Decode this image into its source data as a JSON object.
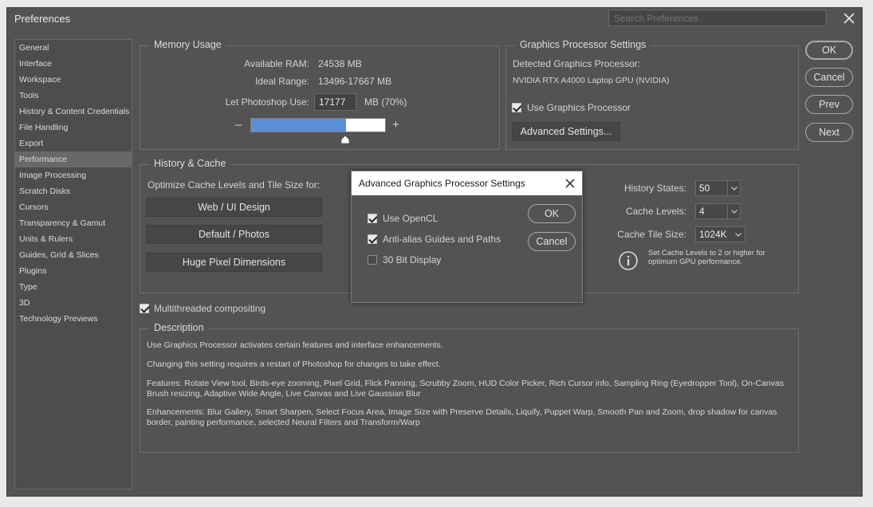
{
  "window": {
    "title": "Preferences",
    "search_placeholder": "Search Preferences"
  },
  "sidebar": {
    "items": [
      {
        "label": "General"
      },
      {
        "label": "Interface"
      },
      {
        "label": "Workspace"
      },
      {
        "label": "Tools"
      },
      {
        "label": "History & Content Credentials"
      },
      {
        "label": "File Handling"
      },
      {
        "label": "Export"
      },
      {
        "label": "Performance"
      },
      {
        "label": "Image Processing"
      },
      {
        "label": "Scratch Disks"
      },
      {
        "label": "Cursors"
      },
      {
        "label": "Transparency & Gamut"
      },
      {
        "label": "Units & Rulers"
      },
      {
        "label": "Guides, Grid & Slices"
      },
      {
        "label": "Plugins"
      },
      {
        "label": "Type"
      },
      {
        "label": "3D"
      },
      {
        "label": "Technology Previews"
      }
    ],
    "active": "Performance"
  },
  "memory": {
    "title": "Memory Usage",
    "available_label": "Available RAM:",
    "available_value": "24538 MB",
    "ideal_label": "Ideal Range:",
    "ideal_value": "13496-17667 MB",
    "let_use_label": "Let Photoshop Use:",
    "let_use_value": "17177",
    "let_use_unit": "MB (70%)",
    "usage_fraction": 0.7,
    "minus": "–",
    "plus": "+"
  },
  "gpu": {
    "title": "Graphics Processor Settings",
    "detected_label": "Detected Graphics Processor:",
    "detected_value": "NVIDIA RTX A4000 Laptop GPU (NVIDIA)",
    "use_gpu_label": "Use Graphics Processor",
    "use_gpu_checked": true,
    "advanced_button": "Advanced Settings..."
  },
  "buttons": {
    "ok": "OK",
    "cancel": "Cancel",
    "prev": "Prev",
    "next": "Next"
  },
  "history_cache": {
    "title": "History & Cache",
    "optimize_label": "Optimize Cache Levels and Tile Size for:",
    "presets": [
      "Web / UI Design",
      "Default / Photos",
      "Huge Pixel Dimensions"
    ],
    "history_states_label": "History States:",
    "history_states_value": "50",
    "cache_levels_label": "Cache Levels:",
    "cache_levels_value": "4",
    "cache_tile_label": "Cache Tile Size:",
    "cache_tile_value": "1024K",
    "info_text": "Set Cache Levels to 2 or higher for optimum GPU performance."
  },
  "multithreaded": {
    "label": "Multithreaded compositing",
    "checked": true
  },
  "description": {
    "title": "Description",
    "paragraphs": [
      "Use Graphics Processor activates certain features and interface enhancements.",
      "Changing this setting requires a restart of Photoshop for changes to take effect.",
      "Features: Rotate View tool, Birds-eye zooming, Pixel Grid, Flick Panning, Scrubby Zoom, HUD Color Picker, Rich Cursor info, Sampling Ring (Eyedropper Tool), On-Canvas Brush resizing, Adaptive Wide Angle, Live Canvas and Live Gaussian Blur",
      "Enhancements: Blur Gallery, Smart Sharpen, Select Focus Area, Image Size with Preserve Details, Liquify, Puppet Warp, Smooth Pan and Zoom, drop shadow for canvas border, painting performance, selected Neural Filters and Transform/Warp"
    ]
  },
  "modal": {
    "title": "Advanced Graphics Processor Settings",
    "options": [
      {
        "label": "Use OpenCL",
        "checked": true
      },
      {
        "label": "Anti-alias Guides and Paths",
        "checked": true
      },
      {
        "label": "30 Bit Display",
        "checked": false
      }
    ],
    "ok": "OK",
    "cancel": "Cancel"
  },
  "colors": {
    "panel": "#535353",
    "accent": "#5a8fd6",
    "border": "#6e6e6e"
  }
}
